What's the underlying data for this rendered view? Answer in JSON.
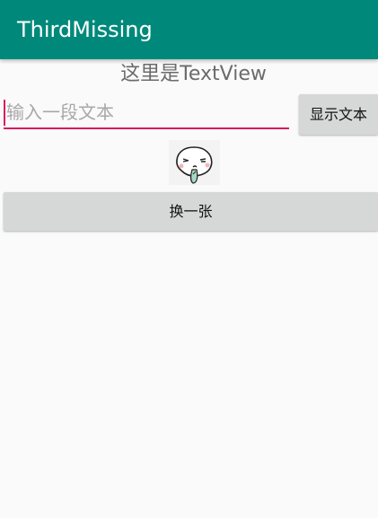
{
  "app": {
    "title": "ThirdMissing"
  },
  "main": {
    "text_view": "这里是TextView",
    "input": {
      "placeholder": "输入一段文本",
      "value": ""
    },
    "show_button_label": "显示文本",
    "swap_button_label": "换一张",
    "image_icon": "cartoon-face-icon"
  },
  "colors": {
    "app_bar": "#00897b",
    "accent": "#d81b60",
    "button": "#d6d7d7"
  }
}
